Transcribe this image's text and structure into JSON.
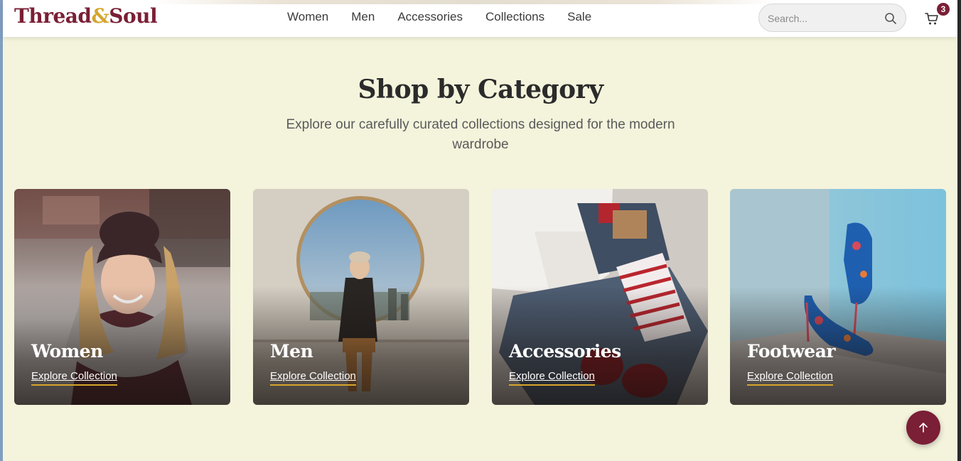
{
  "brand": {
    "logo_part1": "Thread",
    "logo_amp": "&",
    "logo_part2": "Soul",
    "primary_color": "#7a1f35",
    "accent_color": "#d6a52c"
  },
  "nav": {
    "items": [
      "Women",
      "Men",
      "Accessories",
      "Collections",
      "Sale"
    ]
  },
  "search": {
    "placeholder": "Search...",
    "icon": "search-icon"
  },
  "cart": {
    "icon": "cart-icon",
    "count": "3"
  },
  "section": {
    "title": "Shop by Category",
    "subtitle": "Explore our carefully curated collections designed for the modern wardrobe"
  },
  "categories": [
    {
      "title": "Women",
      "link": "Explore Collection"
    },
    {
      "title": "Men",
      "link": "Explore Collection"
    },
    {
      "title": "Accessories",
      "link": "Explore Collection"
    },
    {
      "title": "Footwear",
      "link": "Explore Collection"
    }
  ],
  "back_to_top": {
    "icon": "arrow-up-icon"
  }
}
